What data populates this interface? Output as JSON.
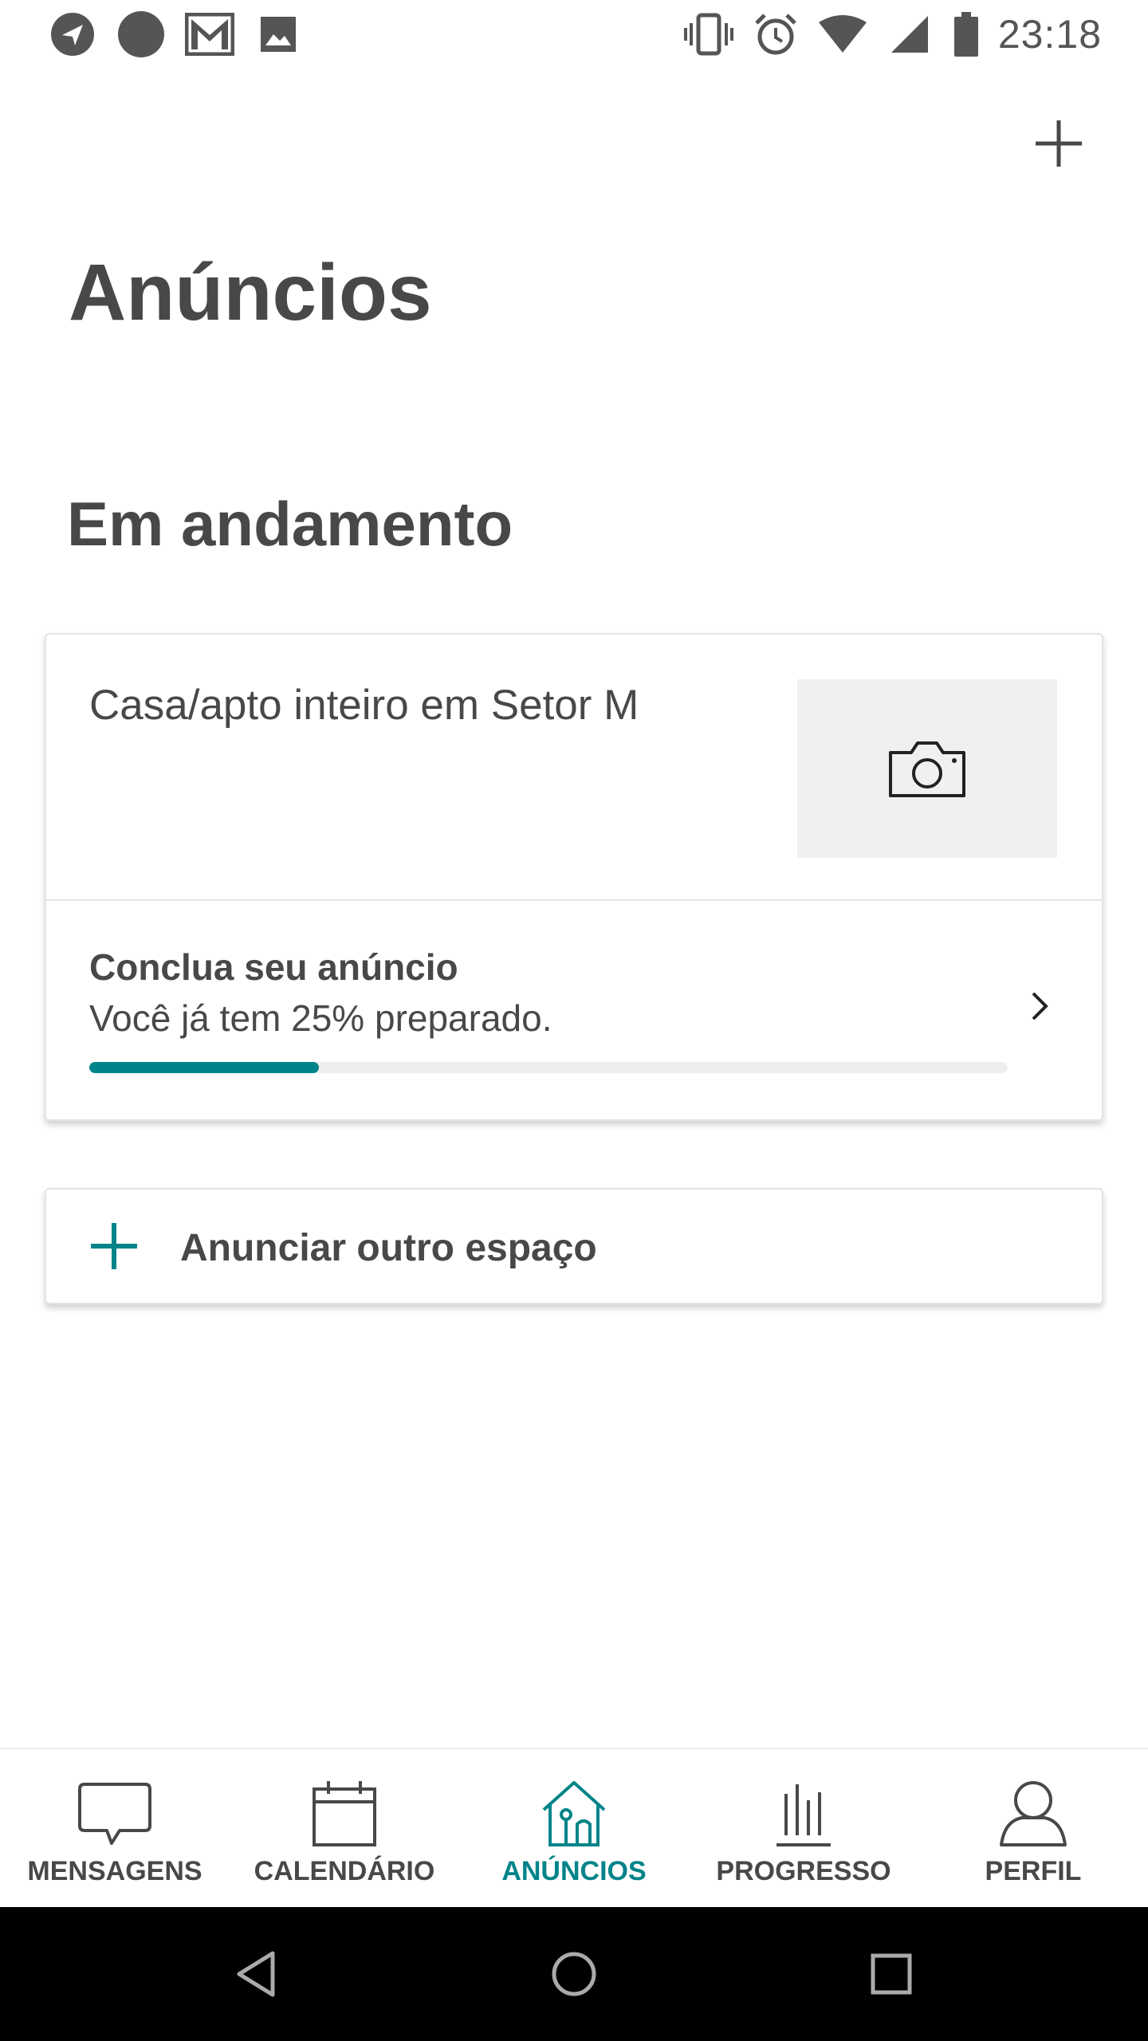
{
  "status_bar": {
    "time": "23:18",
    "left_icons": [
      "navigation-icon",
      "circle-notification-icon",
      "gmail-icon",
      "image-icon"
    ],
    "right_icons": [
      "vibrate-icon",
      "alarm-icon",
      "wifi-icon",
      "signal-icon",
      "battery-icon"
    ]
  },
  "header": {
    "add_icon": "plus-icon"
  },
  "page": {
    "title": "Anúncios",
    "section_title": "Em andamento"
  },
  "listing": {
    "title": "Casa/apto inteiro em Setor M",
    "photo_icon": "camera-icon",
    "finish_title": "Conclua seu anúncio",
    "finish_subtitle": "Você já tem 25% preparado.",
    "progress_percent": 25,
    "progress_color": "#008489"
  },
  "add_listing": {
    "label": "Anunciar outro espaço",
    "icon": "plus-icon",
    "accent": "#008489"
  },
  "bottom_nav": {
    "items": [
      {
        "label": "MENSAGENS",
        "icon": "message-icon",
        "active": false
      },
      {
        "label": "CALENDÁRIO",
        "icon": "calendar-icon",
        "active": false
      },
      {
        "label": "ANÚNCIOS",
        "icon": "home-icon",
        "active": true
      },
      {
        "label": "PROGRESSO",
        "icon": "progress-bars-icon",
        "active": false
      },
      {
        "label": "PERFIL",
        "icon": "profile-icon",
        "active": false
      }
    ],
    "active_color": "#008489"
  },
  "system_nav": {
    "buttons": [
      "back-icon",
      "home-circle-icon",
      "recents-icon"
    ]
  }
}
